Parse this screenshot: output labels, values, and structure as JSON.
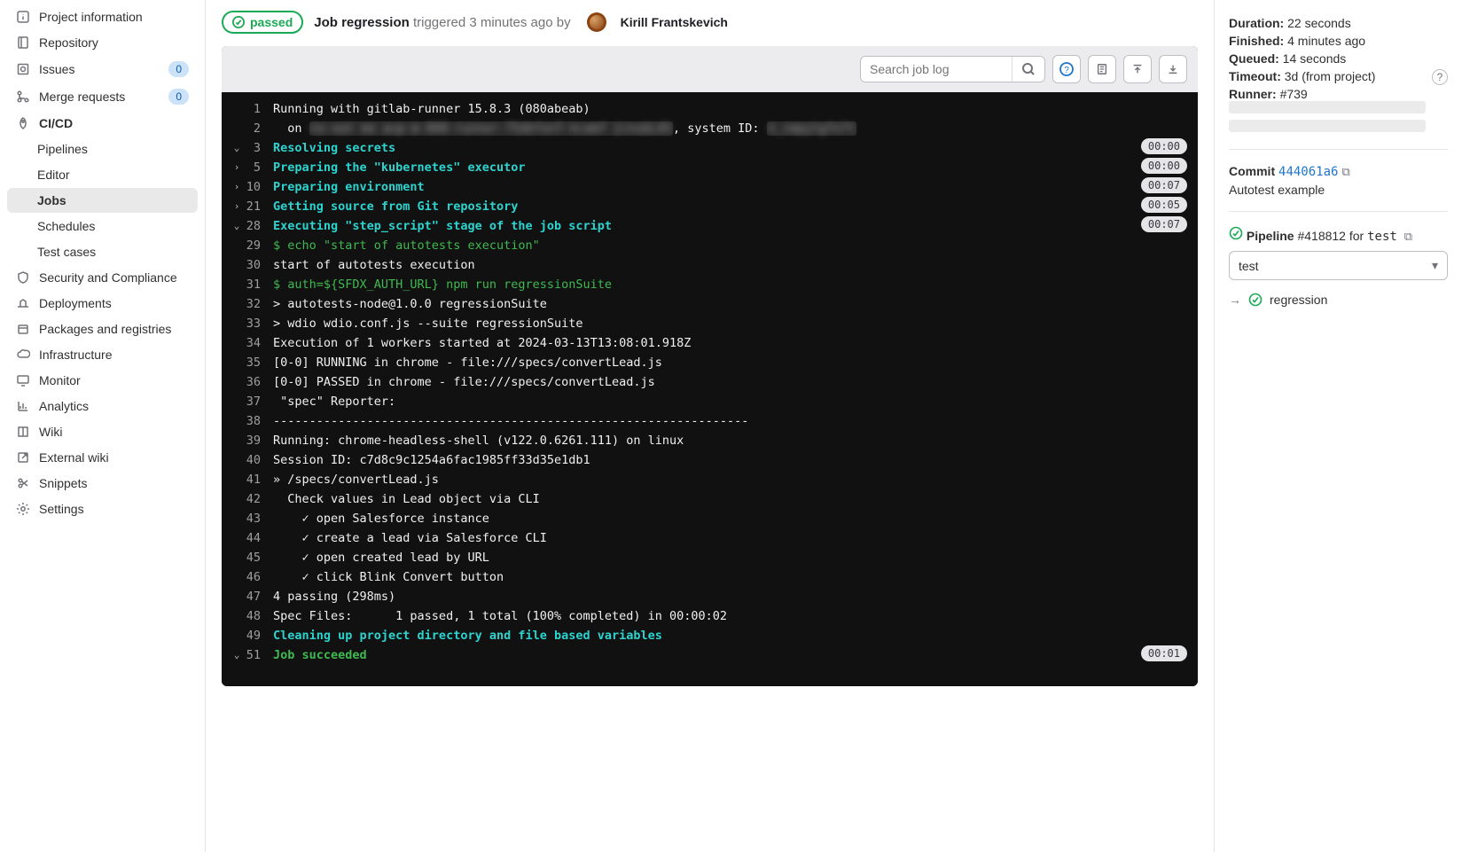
{
  "sidebar": {
    "items": [
      {
        "label": "Project information",
        "icon": "info"
      },
      {
        "label": "Repository",
        "icon": "repo"
      },
      {
        "label": "Issues",
        "icon": "issues",
        "badge": "0"
      },
      {
        "label": "Merge requests",
        "icon": "merge",
        "badge": "0"
      },
      {
        "label": "CI/CD",
        "icon": "rocket",
        "expanded": true,
        "subs": [
          {
            "label": "Pipelines"
          },
          {
            "label": "Editor"
          },
          {
            "label": "Jobs",
            "active": true
          },
          {
            "label": "Schedules"
          },
          {
            "label": "Test cases"
          }
        ]
      },
      {
        "label": "Security and Compliance",
        "icon": "shield"
      },
      {
        "label": "Deployments",
        "icon": "deploy"
      },
      {
        "label": "Packages and registries",
        "icon": "package"
      },
      {
        "label": "Infrastructure",
        "icon": "cloud"
      },
      {
        "label": "Monitor",
        "icon": "monitor"
      },
      {
        "label": "Analytics",
        "icon": "chart"
      },
      {
        "label": "Wiki",
        "icon": "book"
      },
      {
        "label": "External wiki",
        "icon": "external"
      },
      {
        "label": "Snippets",
        "icon": "scissors"
      },
      {
        "label": "Settings",
        "icon": "gear"
      }
    ]
  },
  "header": {
    "status": "passed",
    "job_label": "Job",
    "job_name": "regression",
    "triggered": "triggered 3 minutes ago by",
    "user": "Kirill Frantskevich"
  },
  "toolbar": {
    "search_placeholder": "Search job log"
  },
  "right": {
    "duration_label": "Duration:",
    "duration_value": "22 seconds",
    "finished_label": "Finished:",
    "finished_value": "4 minutes ago",
    "queued_label": "Queued:",
    "queued_value": "14 seconds",
    "timeout_label": "Timeout:",
    "timeout_value": "3d (from project)",
    "runner_label": "Runner:",
    "runner_value": "#739",
    "commit_label": "Commit",
    "commit_sha": "444061a6",
    "commit_msg": "Autotest example",
    "pipeline_label": "Pipeline",
    "pipeline_num": "#418812",
    "pipeline_for": "for",
    "pipeline_branch": "test",
    "stage_selected": "test",
    "related_job": "regression"
  },
  "log": [
    {
      "n": 1,
      "t": "Running with gitlab-runner 15.8.3 (080abeab)"
    },
    {
      "n": 2,
      "t": "  on ",
      "blur_mid": "no-eat me asp-m-000-runner-75dkfon7-kcamf {cnubL45",
      "post": ", system ID: ",
      "blur_end": "n_cmpytgfn7t"
    },
    {
      "n": 3,
      "fold": "down",
      "cls": "sect-cyan",
      "t": "Resolving secrets",
      "timer": "00:00"
    },
    {
      "n": 5,
      "fold": "right",
      "cls": "sect-cyan",
      "t": "Preparing the \"kubernetes\" executor",
      "timer": "00:00"
    },
    {
      "n": 10,
      "fold": "right",
      "cls": "sect-cyan",
      "t": "Preparing environment",
      "timer": "00:07"
    },
    {
      "n": 21,
      "fold": "right",
      "cls": "sect-cyan",
      "t": "Getting source from Git repository",
      "timer": "00:05"
    },
    {
      "n": 28,
      "fold": "down",
      "cls": "sect-cyan",
      "t": "Executing \"step_script\" stage of the job script",
      "timer": "00:07"
    },
    {
      "n": 29,
      "cls": "cmd-green",
      "t": "$ echo \"start of autotests execution\""
    },
    {
      "n": 30,
      "t": "start of autotests execution"
    },
    {
      "n": 31,
      "cls": "cmd-green",
      "t": "$ auth=${SFDX_AUTH_URL} npm run regressionSuite"
    },
    {
      "n": 32,
      "t": "> autotests-node@1.0.0 regressionSuite"
    },
    {
      "n": 33,
      "t": "> wdio wdio.conf.js --suite regressionSuite"
    },
    {
      "n": 34,
      "t": "Execution of 1 workers started at 2024-03-13T13:08:01.918Z"
    },
    {
      "n": 35,
      "t": "[0-0] RUNNING in chrome - file:///specs/convertLead.js"
    },
    {
      "n": 36,
      "t": "[0-0] PASSED in chrome - file:///specs/convertLead.js"
    },
    {
      "n": 37,
      "t": " \"spec\" Reporter:"
    },
    {
      "n": 38,
      "t": "------------------------------------------------------------------"
    },
    {
      "n": 39,
      "t": "Running: chrome-headless-shell (v122.0.6261.111) on linux"
    },
    {
      "n": 40,
      "t": "Session ID: c7d8c9c1254a6fac1985ff33d35e1db1"
    },
    {
      "n": 41,
      "t": "» /specs/convertLead.js"
    },
    {
      "n": 42,
      "t": "  Check values in Lead object via CLI"
    },
    {
      "n": 43,
      "t": "    ✓ open Salesforce instance"
    },
    {
      "n": 44,
      "t": "    ✓ create a lead via Salesforce CLI"
    },
    {
      "n": 45,
      "t": "    ✓ open created lead by URL"
    },
    {
      "n": 46,
      "t": "    ✓ click Blink Convert button"
    },
    {
      "n": 47,
      "t": "4 passing (298ms)"
    },
    {
      "n": 48,
      "t": "Spec Files:      1 passed, 1 total (100% completed) in 00:00:02"
    },
    {
      "n": 49,
      "cls": "sect-cyan",
      "t": "Cleaning up project directory and file based variables"
    },
    {
      "n": 51,
      "fold": "down",
      "cls": "sect-green",
      "t": "Job succeeded",
      "timer": "00:01"
    }
  ]
}
